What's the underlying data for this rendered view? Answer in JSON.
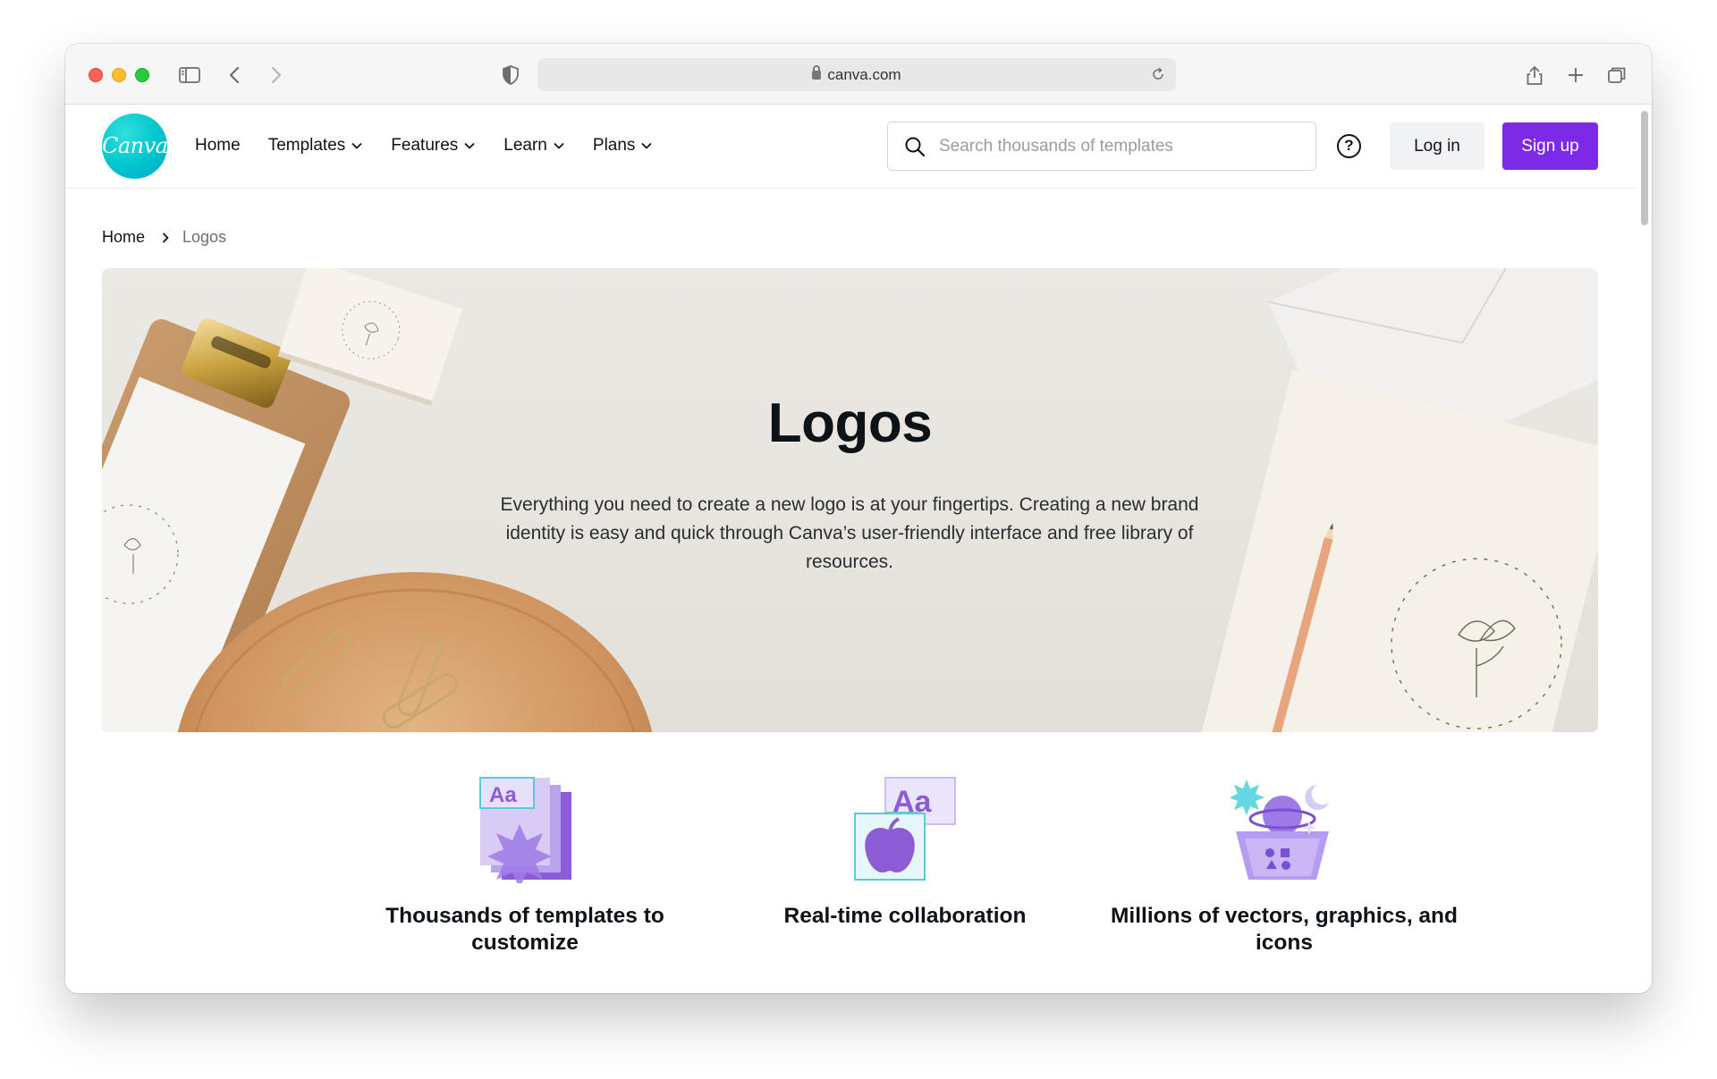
{
  "browser": {
    "url": "canva.com"
  },
  "nav": {
    "logo_text": "Canva",
    "links": [
      {
        "label": "Home",
        "has_menu": false
      },
      {
        "label": "Templates",
        "has_menu": true
      },
      {
        "label": "Features",
        "has_menu": true
      },
      {
        "label": "Learn",
        "has_menu": true
      },
      {
        "label": "Plans",
        "has_menu": true
      }
    ],
    "search_placeholder": "Search thousands of templates",
    "help_label": "?",
    "login_label": "Log in",
    "signup_label": "Sign up"
  },
  "breadcrumb": {
    "home": "Home",
    "current": "Logos"
  },
  "hero": {
    "title": "Logos",
    "description": "Everything you need to create a new logo is at your fingertips. Creating a new brand identity is easy and quick through Canva’s user-friendly interface and free library of resources."
  },
  "features": [
    {
      "title": "Thousands of templates to customize",
      "icon": "templates-icon"
    },
    {
      "title": "Real-time collaboration",
      "icon": "collaboration-icon"
    },
    {
      "title": "Millions of vectors, graphics, and icons",
      "icon": "graphics-icon"
    }
  ],
  "colors": {
    "brand_teal": "#00c4cc",
    "brand_purple": "#7d2ae8"
  }
}
